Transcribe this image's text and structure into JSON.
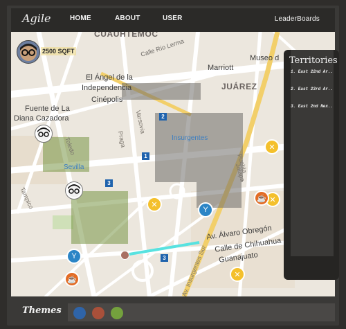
{
  "nav": {
    "brand": "Agile",
    "home": "HOME",
    "about": "ABOUT",
    "user": "USER",
    "leaderboards": "LeaderBoards"
  },
  "user": {
    "area": "2500 SQFT"
  },
  "map_labels": {
    "cuauhtemoc": "CUAUHTÉMOC",
    "calle_rio_lerma": "Calle Río Lerma",
    "museo": "Museo d",
    "marriott": "Marriott",
    "angel": "El Ángel de la",
    "independencia": "Independencia",
    "juarez": "JUÁREZ",
    "cinepolis": "Cinépolis",
    "fuente": "Fuente de La",
    "diana": "Diana Cazadora",
    "insurgentes": "Insurgentes",
    "sevilla": "Sevilla",
    "praga": "Praga",
    "varsovia": "Varsovia",
    "toledo": "Toledo",
    "puebla": "Puebla",
    "jalapa": "Jalapa",
    "tampico": "Tampico",
    "alvaro": "Av. Álvaro Obregón",
    "chihuahua": "Calle de Chihuahua",
    "guanajuato": "Guanajuato",
    "av_insurgentes_sur": "Av. Insurgentes Sur",
    "metro1": "1",
    "metro2": "2",
    "metro3a": "3",
    "metro3b": "3"
  },
  "territories": {
    "title": "Territories",
    "items": [
      "1. East 22nd Ar..",
      "2. East 23rd Ar..",
      "3. East 2nd Nex.."
    ]
  },
  "themes": {
    "label": "Themes",
    "colors": [
      "#2f64a8",
      "#a9503a",
      "#74a13d"
    ]
  },
  "icons": {
    "user_avatar": "nerd-avatar-icon",
    "player_avatar": "player-avatar-icon",
    "restaurant": "restaurant-icon",
    "bar": "cocktail-icon",
    "cafe": "coffee-cup-icon",
    "metro": "metro-icon"
  }
}
